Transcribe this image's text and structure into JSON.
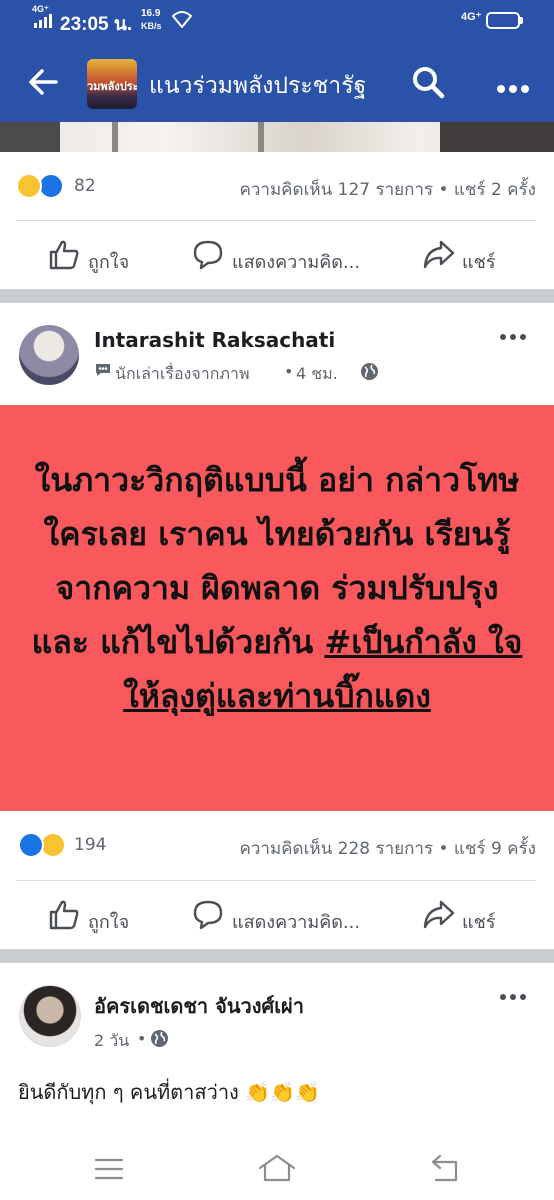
{
  "status_bar": {
    "network_top": "4G⁺",
    "time": "23:05 น.",
    "speed_value": "16.9",
    "speed_unit": "KB/s",
    "network_right": "4G⁺",
    "battery": "62",
    "battery_level": 0.62,
    "color": "#2952a8"
  },
  "app_bar": {
    "back_icon": "arrow-left-icon",
    "thumb_text": "วมพลังประ",
    "title": "แนวร่วมพลังประชารัฐ",
    "search_icon": "search-icon",
    "more_icon": "more-horizontal-icon"
  },
  "post1": {
    "reactions": [
      "haha",
      "like"
    ],
    "reaction_count": "82",
    "meta": "ความคิดเห็น 127 รายการ • แชร์ 2 ครั้ง",
    "actions": {
      "like": "ถูกใจ",
      "comment": "แสดงความคิด...",
      "share": "แชร์"
    }
  },
  "post2": {
    "author": "Intarashit Raksachati",
    "badge": "นักเล่าเรื่องจากภาพ",
    "time": "4 ชม.",
    "banner": {
      "text_plain": "ในภาวะวิกฤติแบบนี้ อย่า กล่าวโทษใครเลย เราคน ไทยด้วยกัน เรียนรู้จากความ ผิดพลาด ร่วมปรับปรุงและ แก้ไขไปด้วยกัน ",
      "hashtag": "#เป็นกำลัง ใจให้ลุงตู่และท่านบิ๊กแดง",
      "background": "#f9595c"
    },
    "reactions": [
      "like",
      "haha"
    ],
    "reaction_count": "194",
    "meta": "ความคิดเห็น 228 รายการ • แชร์ 9 ครั้ง",
    "actions": {
      "like": "ถูกใจ",
      "comment": "แสดงความคิด...",
      "share": "แชร์"
    }
  },
  "post3": {
    "author": "อัครเดชเดชา จันวงศ์เผ่า",
    "time": "2 วัน",
    "text": "ยินดีกับทุก ๆ คนที่ตาสว่าง 👏👏👏"
  },
  "nav": {
    "menu_icon": "menu-icon",
    "home_icon": "home-icon",
    "back_icon": "back-icon"
  }
}
